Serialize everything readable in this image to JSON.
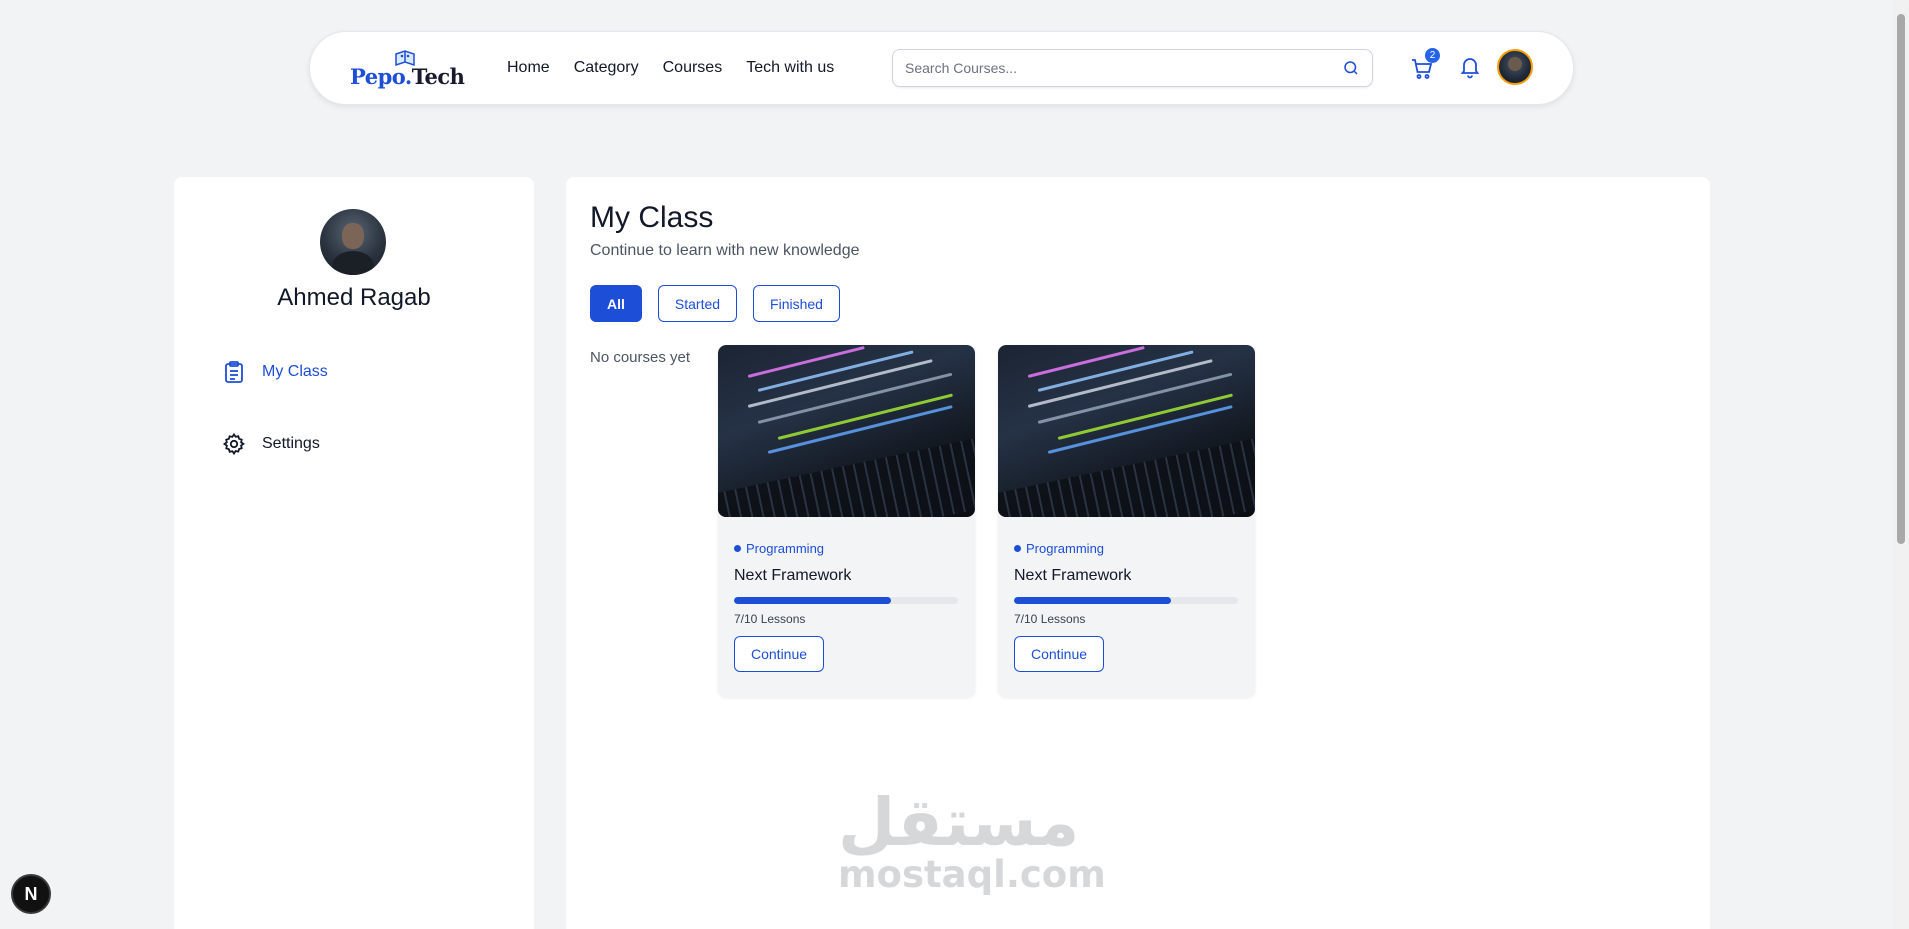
{
  "header": {
    "logo": {
      "brand": "Pepo",
      "suffix": "Tech"
    },
    "nav": [
      {
        "label": "Home"
      },
      {
        "label": "Category"
      },
      {
        "label": "Courses"
      },
      {
        "label": "Tech with us"
      }
    ],
    "search": {
      "placeholder": "Search Courses...",
      "value": ""
    },
    "cart_count": "2",
    "icons": [
      "search-icon",
      "cart-icon",
      "bell-icon"
    ]
  },
  "sidebar": {
    "user_name": "Ahmed Ragab",
    "items": [
      {
        "label": "My Class",
        "icon": "clipboard-icon",
        "active": true
      },
      {
        "label": "Settings",
        "icon": "gear-icon",
        "active": false
      }
    ]
  },
  "main": {
    "title": "My Class",
    "subtitle": "Continue to learn with new knowledge",
    "tabs": [
      {
        "label": "All",
        "active": true
      },
      {
        "label": "Started",
        "active": false
      },
      {
        "label": "Finished",
        "active": false
      }
    ],
    "empty_text": "No courses yet",
    "courses": [
      {
        "category": "Programming",
        "title": "Next Framework",
        "lessons": "7/10 Lessons",
        "progress": 0.7,
        "button": "Continue"
      },
      {
        "category": "Programming",
        "title": "Next Framework",
        "lessons": "7/10 Lessons",
        "progress": 0.7,
        "button": "Continue"
      }
    ]
  },
  "watermark": {
    "arabic": "مستقل",
    "latin": "mostaql.com"
  },
  "dev_badge": "N",
  "colors": {
    "accent": "#1d4ed8",
    "background": "#f2f3f5",
    "avatar_ring": "#f59e0b"
  }
}
